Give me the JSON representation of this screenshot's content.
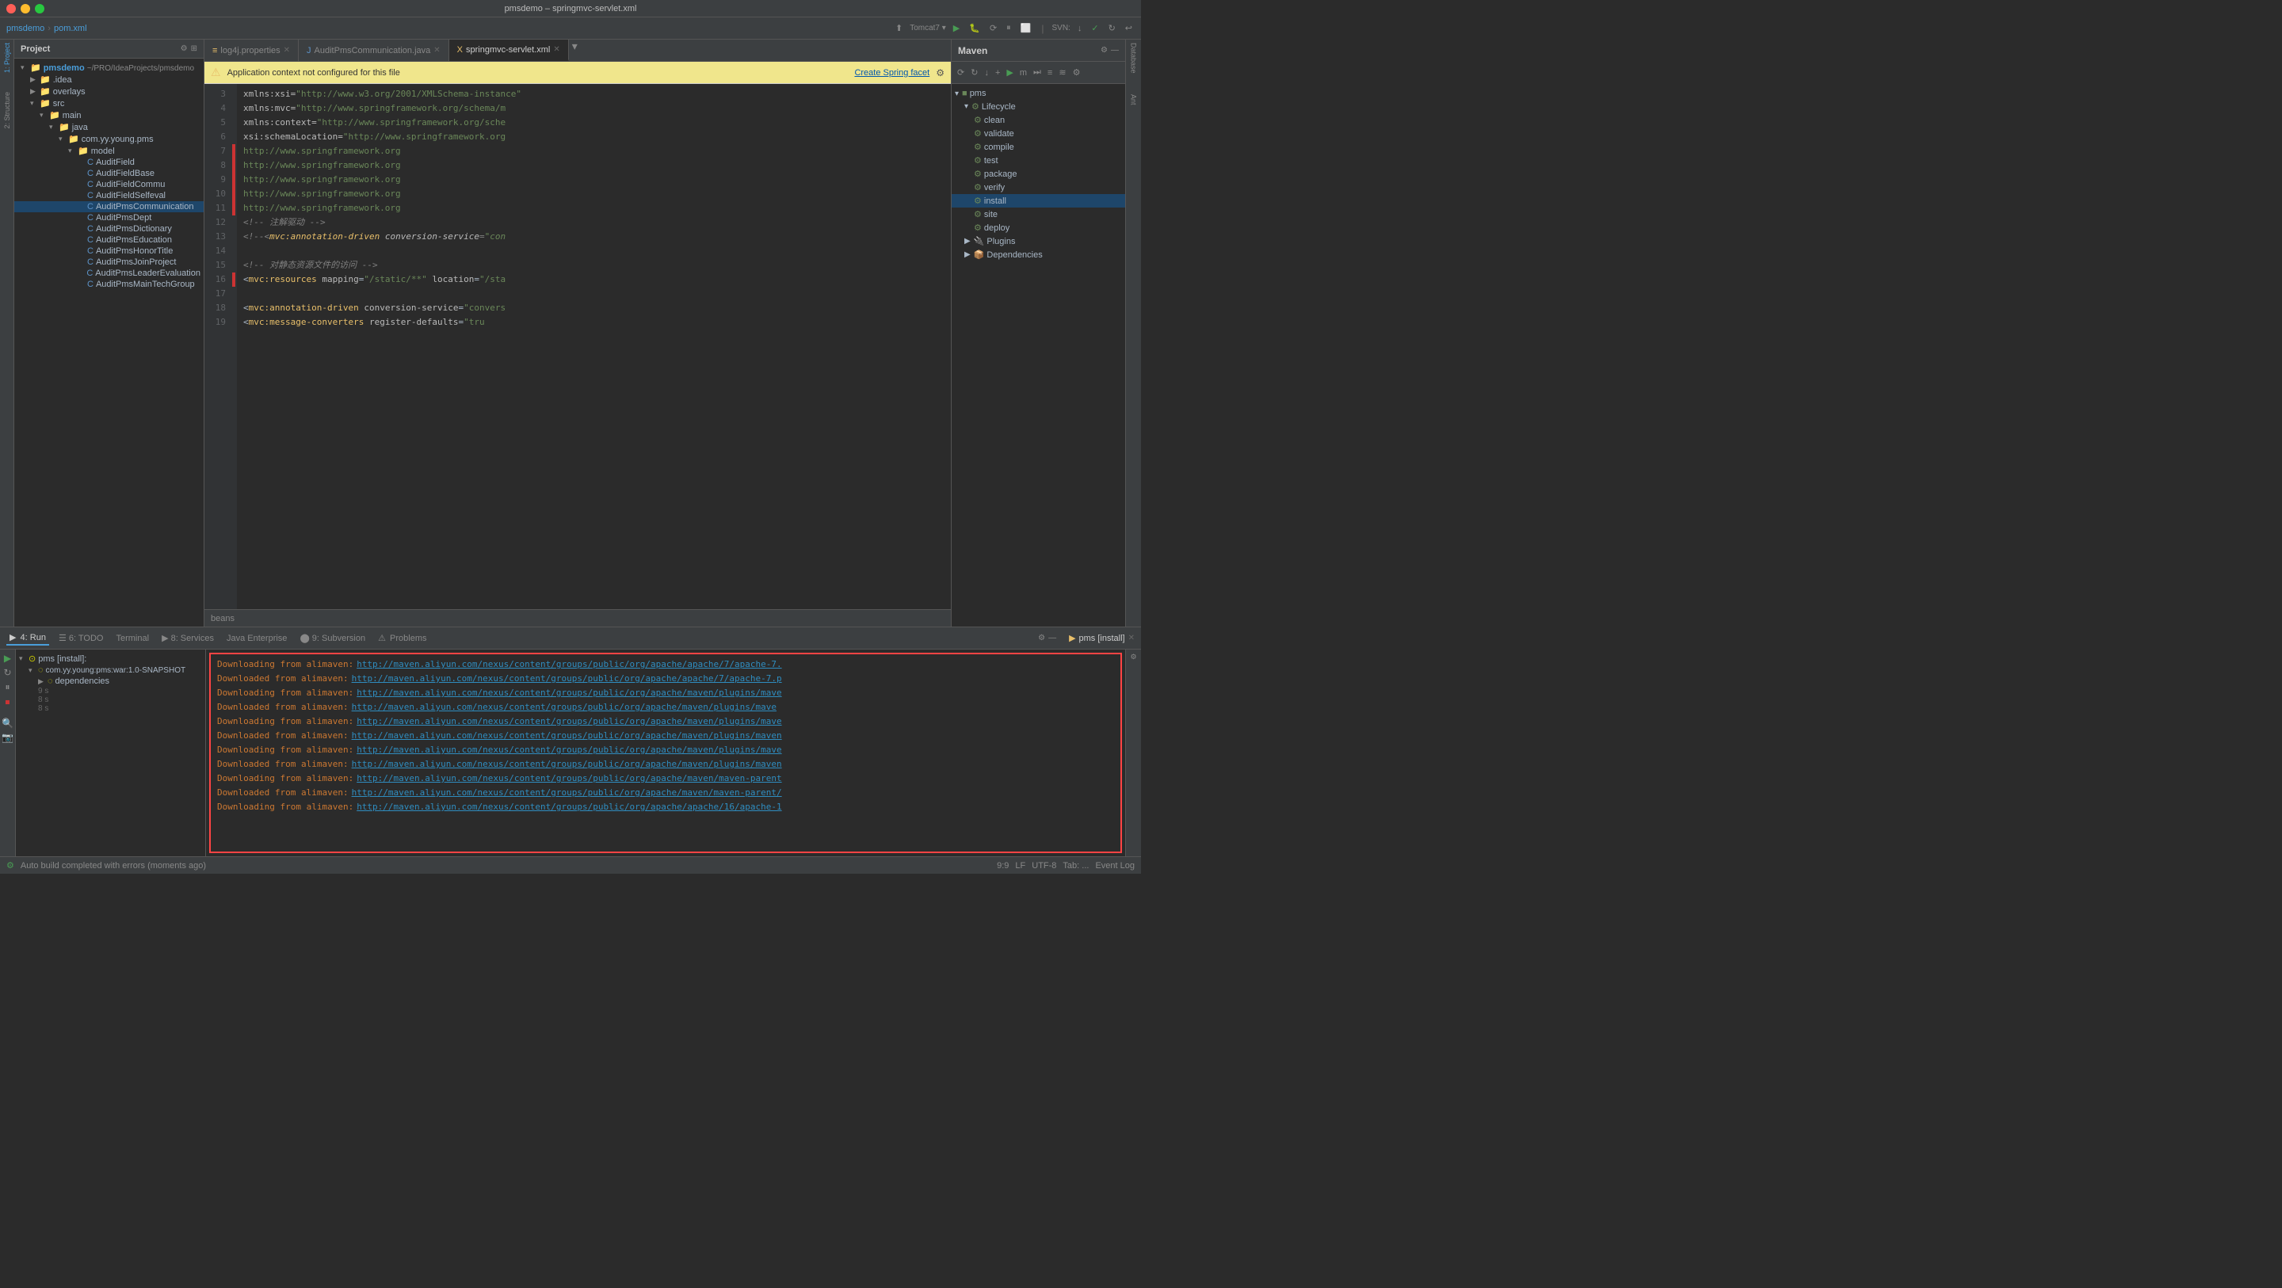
{
  "titleBar": {
    "title": "pmsdemo – springmvc-servlet.xml"
  },
  "topToolbar": {
    "projectName": "pmsdemo",
    "separator": "›",
    "fileName": "pom.xml"
  },
  "projectPanel": {
    "title": "Project",
    "rootItem": "pmsdemo",
    "rootPath": "~/PRO/IdeaProjects/pmsdemo",
    "items": [
      {
        "label": ".idea",
        "indent": 2,
        "type": "folder",
        "expanded": false
      },
      {
        "label": "overlays",
        "indent": 2,
        "type": "folder",
        "expanded": false
      },
      {
        "label": "src",
        "indent": 2,
        "type": "folder",
        "expanded": true
      },
      {
        "label": "main",
        "indent": 3,
        "type": "folder",
        "expanded": true
      },
      {
        "label": "java",
        "indent": 4,
        "type": "folder",
        "expanded": true
      },
      {
        "label": "com.yy.young.pms",
        "indent": 5,
        "type": "folder",
        "expanded": true
      },
      {
        "label": "model",
        "indent": 6,
        "type": "folder",
        "expanded": true
      },
      {
        "label": "AuditField",
        "indent": 7,
        "type": "java"
      },
      {
        "label": "AuditFieldBase",
        "indent": 7,
        "type": "java"
      },
      {
        "label": "AuditFieldCommu",
        "indent": 7,
        "type": "java"
      },
      {
        "label": "AuditFieldSelfeval",
        "indent": 7,
        "type": "java"
      },
      {
        "label": "AuditPmsCommunication",
        "indent": 7,
        "type": "java",
        "selected": true
      },
      {
        "label": "AuditPmsDept",
        "indent": 7,
        "type": "java"
      },
      {
        "label": "AuditPmsDictionary",
        "indent": 7,
        "type": "java"
      },
      {
        "label": "AuditPmsEducation",
        "indent": 7,
        "type": "java"
      },
      {
        "label": "AuditPmsHonorTitle",
        "indent": 7,
        "type": "java"
      },
      {
        "label": "AuditPmsJoinProject",
        "indent": 7,
        "type": "java"
      },
      {
        "label": "AuditPmsLeaderEvaluation",
        "indent": 7,
        "type": "java"
      },
      {
        "label": "AuditPmsMainTechGroup",
        "indent": 7,
        "type": "java"
      }
    ]
  },
  "tabs": [
    {
      "label": "log4j.properties",
      "active": false,
      "icon": "props"
    },
    {
      "label": "AuditPmsCommunication.java",
      "active": false,
      "icon": "java"
    },
    {
      "label": "springmvc-servlet.xml",
      "active": true,
      "icon": "xml"
    }
  ],
  "notification": {
    "text": "Application context not configured for this file",
    "linkText": "Create Spring facet",
    "settingsIcon": "⚙"
  },
  "codeLines": [
    {
      "num": "3",
      "content": "    xmlns:xsi=\"http://www.w3.org/2001/XMLSchema-instance\"",
      "type": "attr"
    },
    {
      "num": "4",
      "content": "    xmlns:mvc=\"http://www.springframework.org/schema/m",
      "type": "attr"
    },
    {
      "num": "5",
      "content": "    xmlns:context=\"http://www.springframework.org/sche",
      "type": "attr"
    },
    {
      "num": "6",
      "content": "    xsi:schemaLocation=\"http://www.springframework.org",
      "type": "attr"
    },
    {
      "num": "7",
      "content": "                       http://www.springframework.org",
      "type": "str"
    },
    {
      "num": "8",
      "content": "                       http://www.springframework.org",
      "type": "str"
    },
    {
      "num": "9",
      "content": "                       http://www.springframework.org",
      "type": "str"
    },
    {
      "num": "10",
      "content": "                       http://www.springframework.org",
      "type": "str"
    },
    {
      "num": "11",
      "content": "                       http://www.springframework.org",
      "type": "str"
    },
    {
      "num": "12",
      "content": "    <!-- 注解驱动 -->",
      "type": "comment"
    },
    {
      "num": "13",
      "content": "    <!--<mvc:annotation-driven conversion-service=\"con",
      "type": "comment"
    },
    {
      "num": "14",
      "content": "",
      "type": "blank"
    },
    {
      "num": "15",
      "content": "    <!-- 对静态资源文件的访问 -->",
      "type": "comment"
    },
    {
      "num": "16",
      "content": "    <mvc:resources mapping=\"/static/**\" location=\"/sta",
      "type": "code"
    },
    {
      "num": "17",
      "content": "",
      "type": "blank"
    },
    {
      "num": "18",
      "content": "    <mvc:annotation-driven conversion-service=\"convers",
      "type": "code"
    },
    {
      "num": "19",
      "content": "        <mvc:message-converters register-defaults=\"tru",
      "type": "code"
    }
  ],
  "breadcrumbBottom": {
    "label": "beans"
  },
  "maven": {
    "title": "Maven",
    "items": [
      {
        "label": "pms",
        "indent": 0,
        "type": "root",
        "expanded": true
      },
      {
        "label": "Lifecycle",
        "indent": 1,
        "type": "folder",
        "expanded": true
      },
      {
        "label": "clean",
        "indent": 2,
        "type": "lifecycle"
      },
      {
        "label": "validate",
        "indent": 2,
        "type": "lifecycle"
      },
      {
        "label": "compile",
        "indent": 2,
        "type": "lifecycle"
      },
      {
        "label": "test",
        "indent": 2,
        "type": "lifecycle"
      },
      {
        "label": "package",
        "indent": 2,
        "type": "lifecycle"
      },
      {
        "label": "verify",
        "indent": 2,
        "type": "lifecycle"
      },
      {
        "label": "install",
        "indent": 2,
        "type": "lifecycle",
        "selected": true
      },
      {
        "label": "site",
        "indent": 2,
        "type": "lifecycle"
      },
      {
        "label": "deploy",
        "indent": 2,
        "type": "lifecycle"
      },
      {
        "label": "Plugins",
        "indent": 1,
        "type": "folder",
        "expanded": false
      },
      {
        "label": "Dependencies",
        "indent": 1,
        "type": "folder",
        "expanded": false
      }
    ]
  },
  "runPanel": {
    "tabLabel": "Run",
    "runTabName": "pms [install]",
    "treeItems": [
      {
        "label": "pms [install]:",
        "indent": 0,
        "type": "run"
      },
      {
        "label": "com.yy.young:pms:war:1.0-SNAPSHOT",
        "indent": 1,
        "type": "artifact"
      },
      {
        "label": "dependencies",
        "indent": 2,
        "type": "deps"
      }
    ],
    "outputLines": [
      {
        "prefix": "Downloading from alimaven:",
        "url": "http://maven.aliyun.com/nexus/content/groups/public/org/apache/apache/7/apache-7.",
        "suffix": ""
      },
      {
        "prefix": "Downloaded from alimaven:",
        "url": "http://maven.aliyun.com/nexus/content/groups/public/org/apache/apache/7/apache-7.p",
        "suffix": ""
      },
      {
        "prefix": "Downloading from alimaven:",
        "url": "http://maven.aliyun.com/nexus/content/groups/public/org/apache/maven/plugins/mave",
        "suffix": ""
      },
      {
        "prefix": "Downloaded from alimaven:",
        "url": "http://maven.aliyun.com/nexus/content/groups/public/org/apache/maven/plugins/mave",
        "suffix": ""
      },
      {
        "prefix": "Downloading from alimaven:",
        "url": "http://maven.aliyun.com/nexus/content/groups/public/org/apache/maven/plugins/mave",
        "suffix": ""
      },
      {
        "prefix": "Downloaded from alimaven:",
        "url": "http://maven.aliyun.com/nexus/content/groups/public/org/apache/maven/plugins/maven",
        "suffix": ""
      },
      {
        "prefix": "Downloading from alimaven:",
        "url": "http://maven.aliyun.com/nexus/content/groups/public/org/apache/maven/plugins/mave",
        "suffix": ""
      },
      {
        "prefix": "Downloaded from alimaven:",
        "url": "http://maven.aliyun.com/nexus/content/groups/public/org/apache/maven/plugins/maven",
        "suffix": ""
      },
      {
        "prefix": "Downloading from alimaven:",
        "url": "http://maven.aliyun.com/nexus/content/groups/public/org/apache/maven/maven-parent",
        "suffix": ""
      },
      {
        "prefix": "Downloaded from alimaven:",
        "url": "http://maven.aliyun.com/nexus/content/groups/public/org/apache/maven/maven-parent/",
        "suffix": ""
      },
      {
        "prefix": "Downloading from alimaven:",
        "url": "http://maven.aliyun.com/nexus/content/groups/public/org/apache/apache/16/apache-1",
        "suffix": ""
      }
    ]
  },
  "statusBar": {
    "leftText": "Auto build completed with errors (moments ago)",
    "bottomTabs": [
      {
        "label": "▶ 4: Run",
        "active": true
      },
      {
        "label": "☰ 6: TODO",
        "active": false
      },
      {
        "label": "Terminal",
        "active": false
      },
      {
        "label": "▶ 8: Services",
        "active": false
      },
      {
        "label": "Java Enterprise",
        "active": false
      },
      {
        "label": "9: Subversion",
        "active": false
      },
      {
        "label": "⚠ Problems",
        "active": false
      }
    ],
    "rightItems": [
      {
        "label": "9:9"
      },
      {
        "label": "LF"
      },
      {
        "label": "UTF-8"
      },
      {
        "label": "Tab: ..."
      }
    ],
    "eventLog": "Event Log"
  }
}
